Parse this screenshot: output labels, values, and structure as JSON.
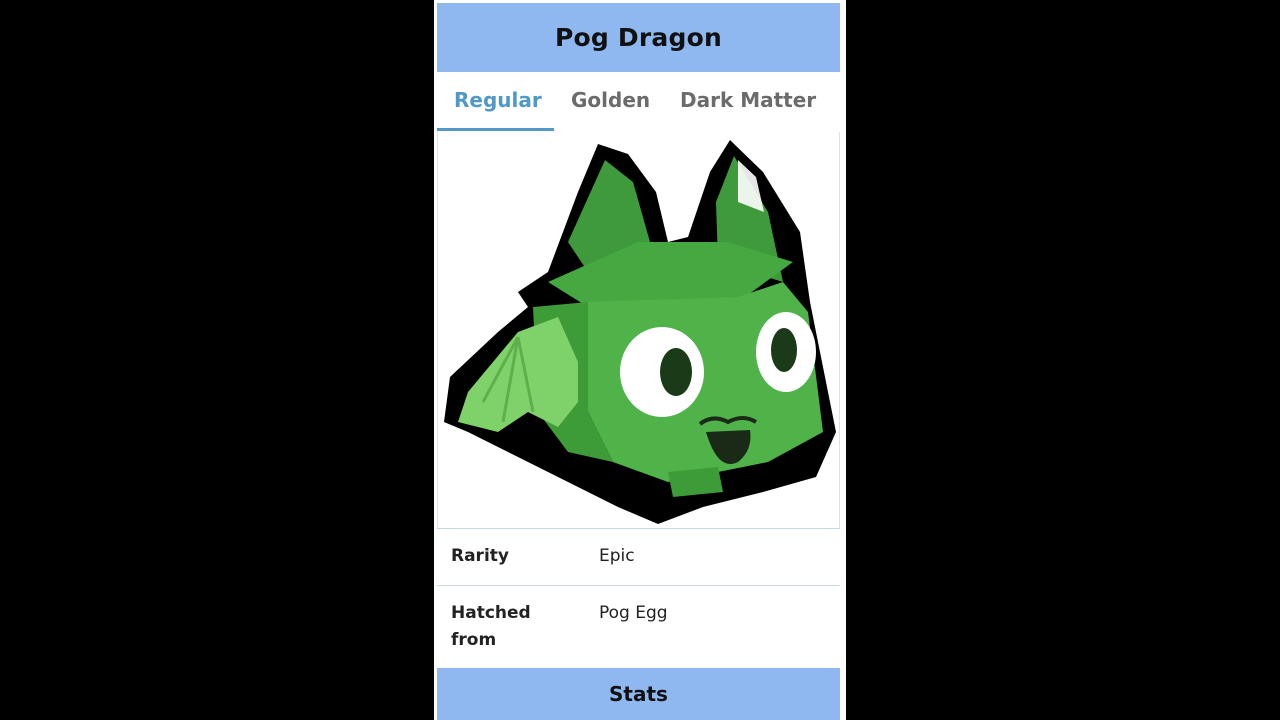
{
  "infobox": {
    "title": "Pog Dragon",
    "tabs": [
      {
        "label": "Regular",
        "active": true
      },
      {
        "label": "Golden",
        "active": false
      },
      {
        "label": "Dark Matter",
        "active": false
      }
    ],
    "image_icon": "green-cube-dragon-pet",
    "rows": [
      {
        "label": "Rarity",
        "value": "Epic"
      },
      {
        "label": "Hatched from",
        "value": "Pog Egg"
      }
    ],
    "section_header": "Stats"
  },
  "colors": {
    "header_blue": "#8fb8f0",
    "tab_active": "#4f98c8",
    "tab_inactive": "#6b6b6b",
    "pet_green": "#4fb34a",
    "background": "#000000"
  }
}
